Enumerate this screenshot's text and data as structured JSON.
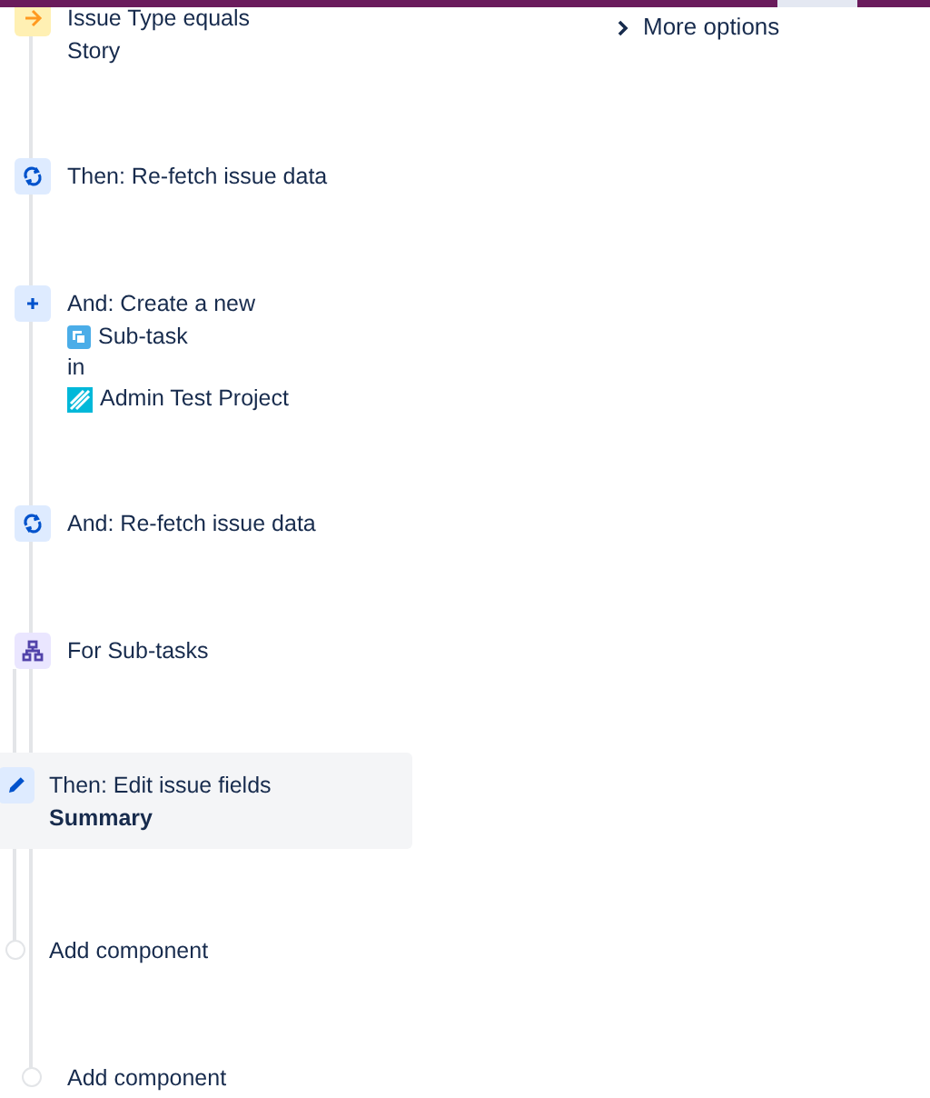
{
  "top_bar": {
    "more_options": "More options"
  },
  "components": [
    {
      "kind": "condition",
      "title": "Issue Type equals",
      "selected": false,
      "details": [
        {
          "kind": "text",
          "text": "Story"
        }
      ]
    },
    {
      "kind": "refetch",
      "title": "Then: Re-fetch issue data",
      "selected": false
    },
    {
      "kind": "create",
      "title": "And: Create a new",
      "selected": false,
      "details": [
        {
          "kind": "issue_type",
          "text": "Sub-task"
        },
        {
          "kind": "text",
          "text": "in"
        },
        {
          "kind": "project",
          "text": "Admin Test Project"
        }
      ]
    },
    {
      "kind": "refetch",
      "title": "And: Re-fetch issue data",
      "selected": false
    },
    {
      "kind": "branch",
      "title": "For Sub-tasks",
      "selected": false,
      "children": [
        {
          "kind": "edit",
          "title": "Then: Edit issue fields",
          "selected": true,
          "details": [
            {
              "kind": "field",
              "text": "Summary"
            }
          ]
        },
        {
          "kind": "add",
          "title": "Add component",
          "selected": false
        }
      ]
    },
    {
      "kind": "add",
      "title": "Add component",
      "selected": false
    }
  ]
}
